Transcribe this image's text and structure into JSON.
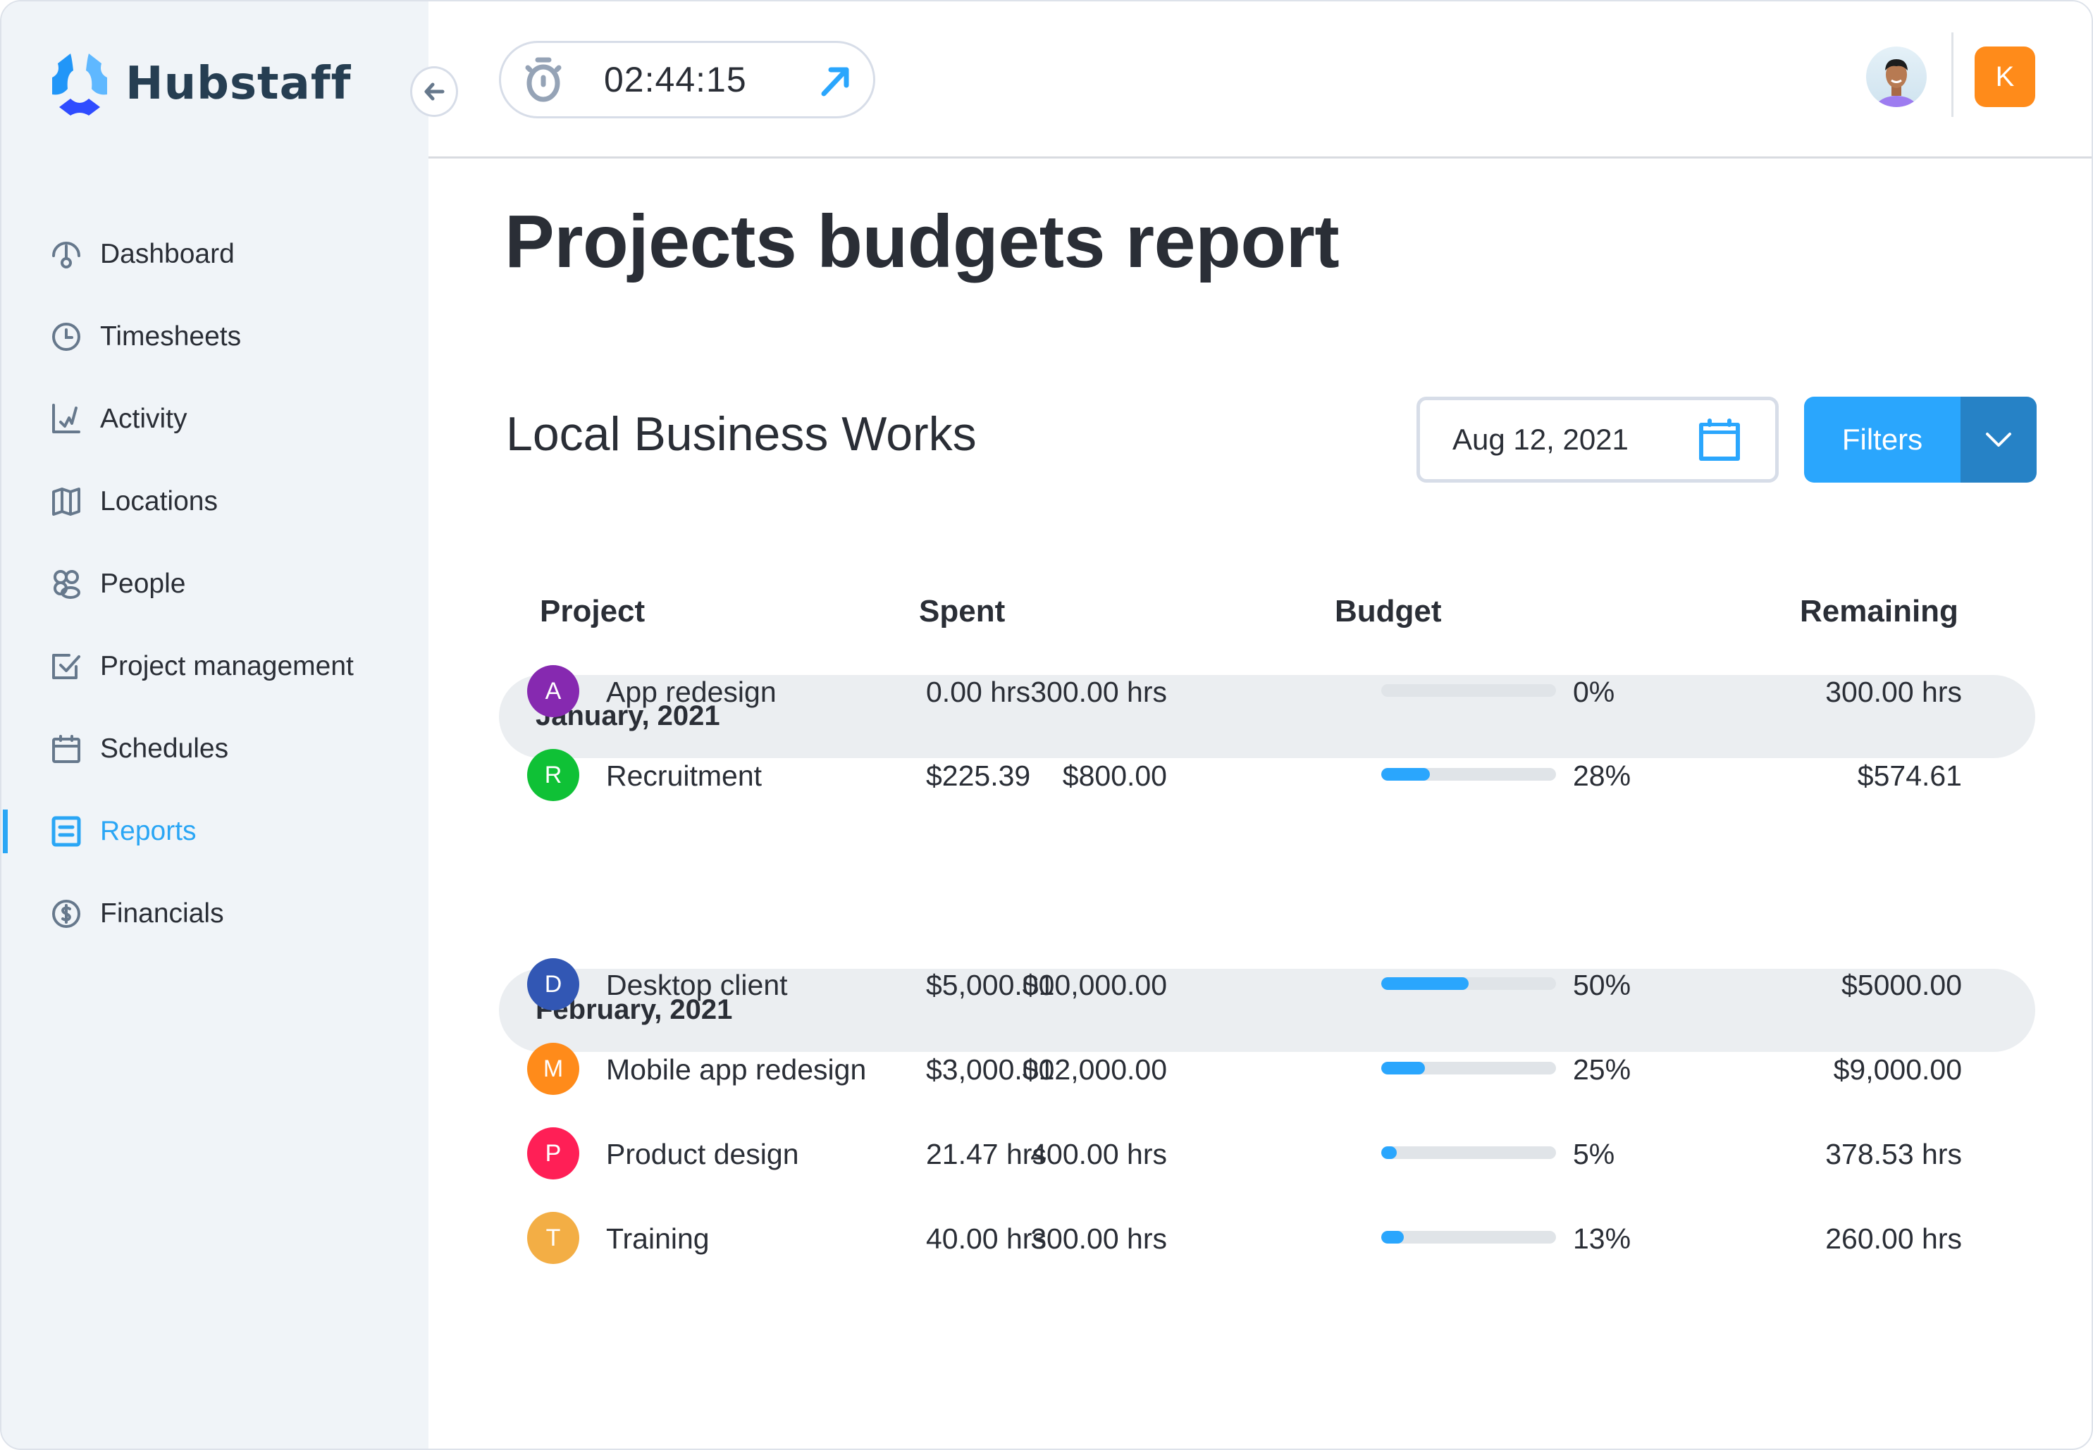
{
  "app": {
    "brand": "Hubstaff",
    "colors": {
      "accent": "#2aa6fd",
      "accent_dark": "#2682c6",
      "sidebar_bg": "#f0f4f8",
      "org_badge": "#ff8b1a"
    }
  },
  "topbar": {
    "timer": {
      "icon": "stopwatch-icon",
      "time": "02:44:15",
      "launch_icon": "arrow-up-right-icon"
    },
    "collapse_icon": "arrow-left-icon",
    "user_avatar": "user-avatar-photo",
    "org_badge": {
      "letter": "K"
    }
  },
  "sidebar": {
    "items": [
      {
        "label": "Dashboard",
        "icon": "dashboard-gauge-icon",
        "active": false
      },
      {
        "label": "Timesheets",
        "icon": "clock-icon",
        "active": false
      },
      {
        "label": "Activity",
        "icon": "activity-chart-icon",
        "active": false
      },
      {
        "label": "Locations",
        "icon": "map-icon",
        "active": false
      },
      {
        "label": "People",
        "icon": "people-icon",
        "active": false
      },
      {
        "label": "Project management",
        "icon": "checkbox-icon",
        "active": false
      },
      {
        "label": "Schedules",
        "icon": "calendar-icon",
        "active": false
      },
      {
        "label": "Reports",
        "icon": "report-icon",
        "active": true
      },
      {
        "label": "Financials",
        "icon": "dollar-icon",
        "active": false
      }
    ]
  },
  "main": {
    "title": "Projects budgets report",
    "organization": "Local Business Works",
    "date_picker": {
      "value": "Aug 12, 2021",
      "icon": "calendar-icon"
    },
    "filters": {
      "label": "Filters",
      "caret_icon": "chevron-down-icon"
    },
    "columns": [
      "Project",
      "Spent",
      "Budget",
      "Remaining"
    ],
    "groups": [
      {
        "label": "January, 2021",
        "rows": [
          {
            "initial": "A",
            "color": "#8629b0",
            "name": "App redesign",
            "spent": "0.00 hrs",
            "budget": "300.00 hrs",
            "progress": 0,
            "percent": "0%",
            "remaining": "300.00 hrs"
          },
          {
            "initial": "R",
            "color": "#0fc136",
            "name": "Recruitment",
            "spent": "$225.39",
            "budget": "$800.00",
            "progress": 28,
            "percent": "28%",
            "remaining": "$574.61"
          }
        ]
      },
      {
        "label": "February, 2021",
        "rows": [
          {
            "initial": "D",
            "color": "#3257b4",
            "name": "Desktop client",
            "spent": "$5,000.00",
            "budget": "$10,000.00",
            "progress": 50,
            "percent": "50%",
            "remaining": "$5000.00"
          },
          {
            "initial": "M",
            "color": "#ff8b1a",
            "name": "Mobile app redesign",
            "spent": "$3,000.00",
            "budget": "$12,000.00",
            "progress": 25,
            "percent": "25%",
            "remaining": "$9,000.00"
          },
          {
            "initial": "P",
            "color": "#ff1f56",
            "name": "Product design",
            "spent": "21.47 hrs",
            "budget": "400.00 hrs",
            "progress": 5,
            "percent": "5%",
            "remaining": "378.53 hrs"
          },
          {
            "initial": "T",
            "color": "#f3ae45",
            "name": "Training",
            "spent": "40.00 hrs",
            "budget": "300.00 hrs",
            "progress": 13,
            "percent": "13%",
            "remaining": "260.00 hrs"
          }
        ]
      }
    ]
  }
}
